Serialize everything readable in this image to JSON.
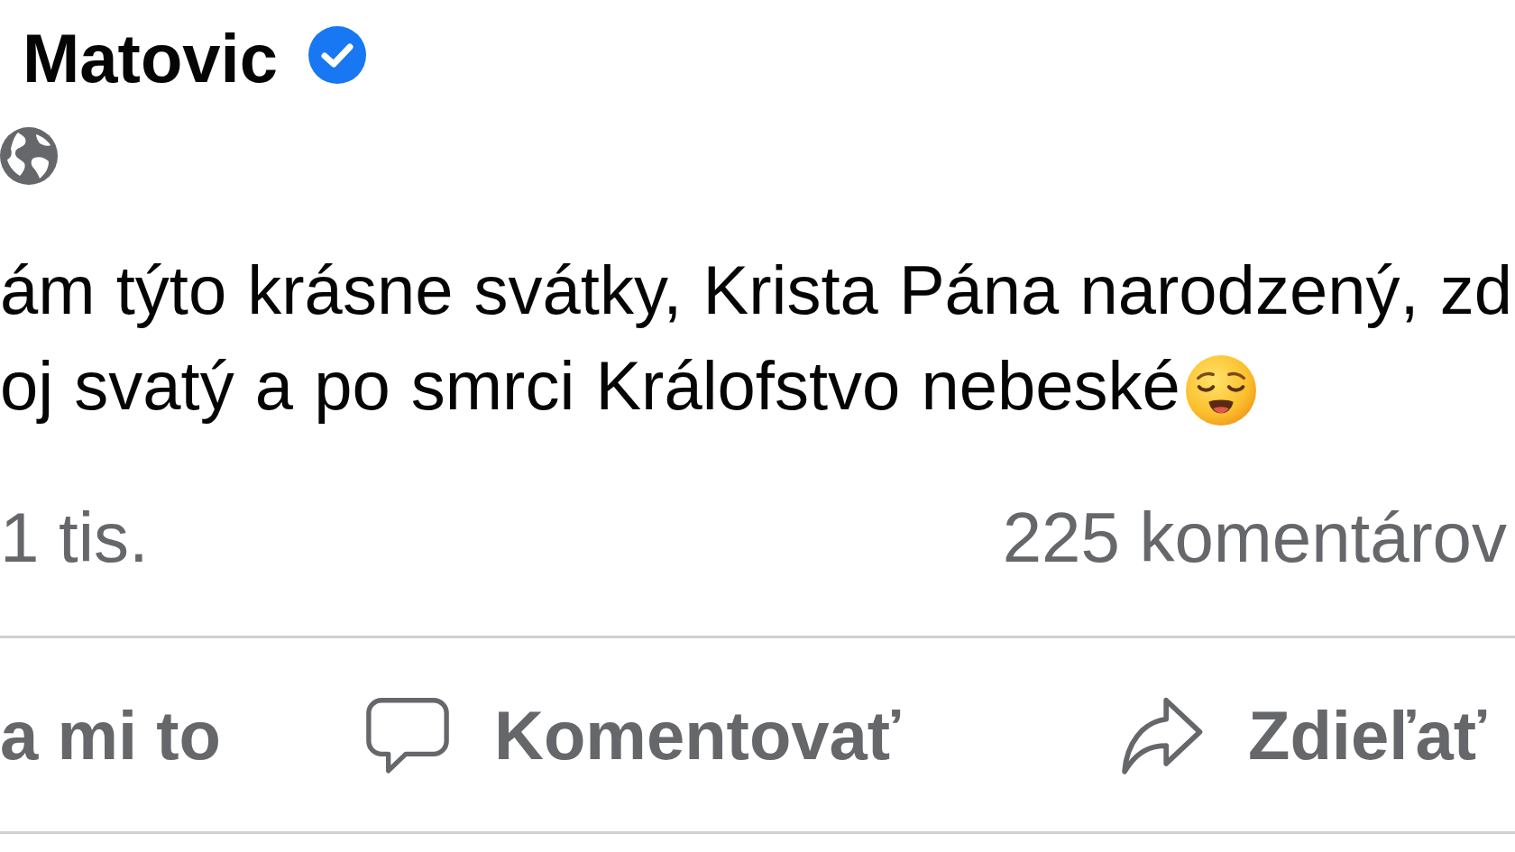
{
  "post": {
    "author": {
      "name": "Matovic",
      "verified": true
    },
    "public": true,
    "text_lines": [
      "ám týto krásne svátky, Krista Pána narodzený, zd",
      "oj svatý a po smrci Králofstvo nebeské"
    ],
    "reactions_count": "1 tis.",
    "comments_count": "225 komentárov",
    "actions": [
      {
        "kind": "like",
        "label": "a mi to"
      },
      {
        "kind": "comment",
        "label": "Komentovať"
      },
      {
        "kind": "share",
        "label": "Zdieľať"
      }
    ]
  }
}
